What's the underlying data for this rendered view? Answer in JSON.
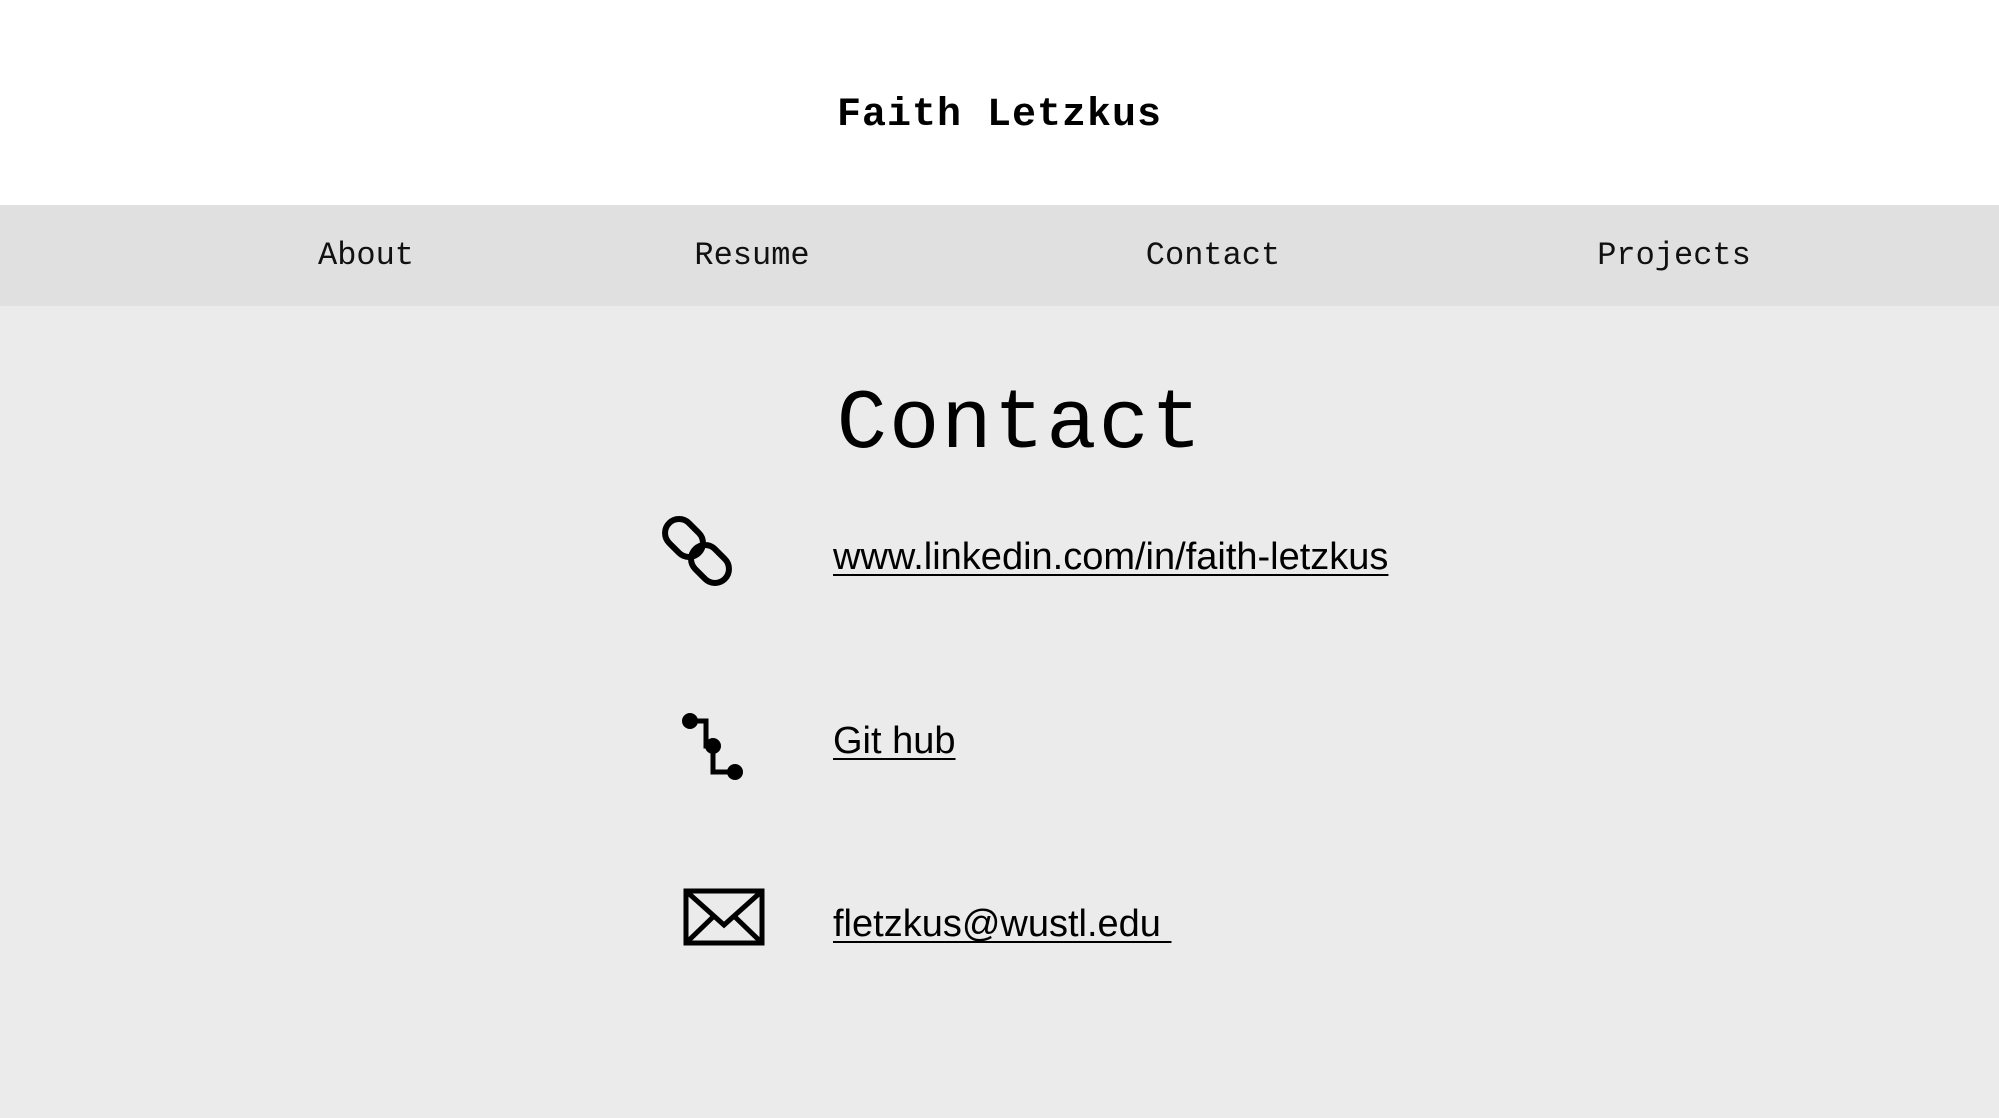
{
  "header": {
    "site_title": "Faith Letzkus"
  },
  "nav": {
    "items": [
      {
        "label": "About"
      },
      {
        "label": "Resume"
      },
      {
        "label": "Contact"
      },
      {
        "label": "Projects"
      }
    ]
  },
  "main": {
    "heading": "Contact",
    "contacts": [
      {
        "icon": "link-icon",
        "label": "www.linkedin.com/in/faith-letzkus"
      },
      {
        "icon": "git-branch-icon",
        "label": "Git hub"
      },
      {
        "icon": "envelope-icon",
        "label": "fletzkus@wustl.edu "
      }
    ]
  }
}
